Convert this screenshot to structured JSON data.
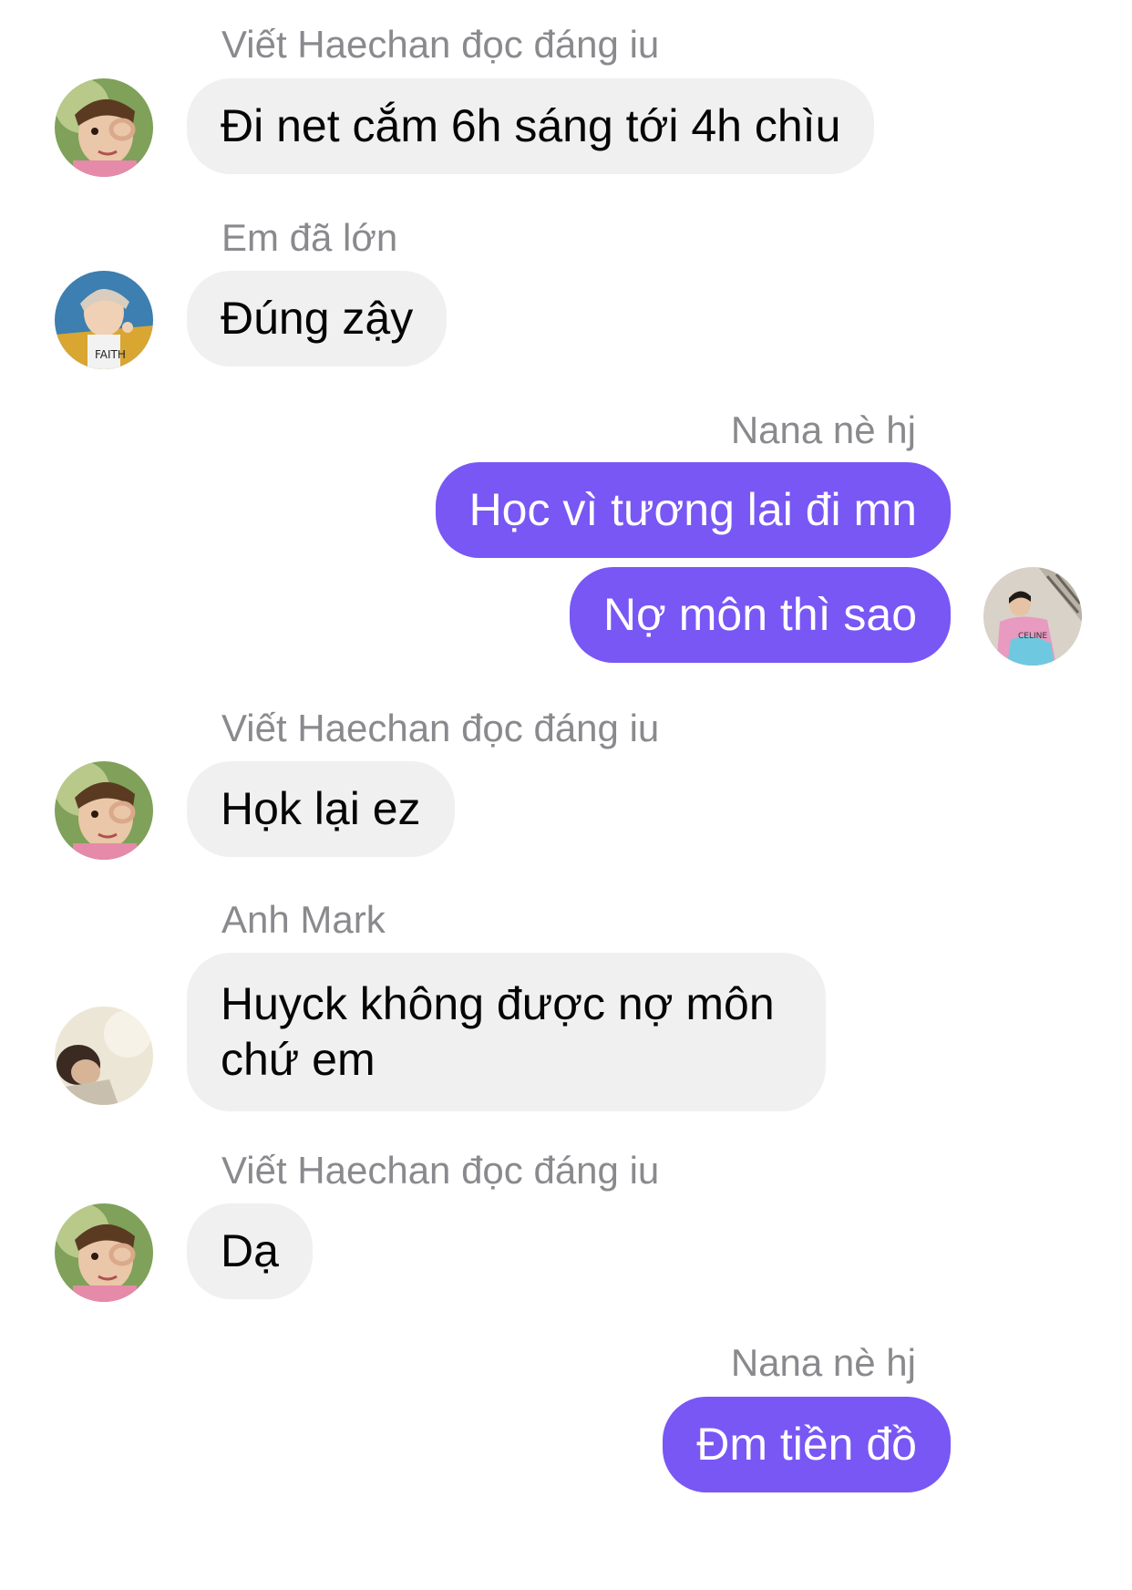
{
  "messages": [
    {
      "sender": "Viết Haechan đọc đáng iu",
      "text": "Đi net cắm 6h sáng tới 4h chìu",
      "avatar": "haechan-avatar"
    },
    {
      "sender": "Em đã lớn",
      "text": "Đúng zậy",
      "avatar": "em-da-lon-avatar"
    },
    {
      "sender": "Nana nè hj",
      "texts": [
        "Học vì tương lai đi mn",
        "Nợ môn thì sao"
      ],
      "avatar": "nana-avatar"
    },
    {
      "sender": "Viết Haechan đọc đáng iu",
      "text": "Họk lại ez",
      "avatar": "haechan-avatar"
    },
    {
      "sender": "Anh Mark",
      "text": "Huyck không được nợ môn chứ em",
      "avatar": "mark-avatar"
    },
    {
      "sender": "Viết Haechan đọc đáng iu",
      "text": "Dạ",
      "avatar": "haechan-avatar"
    },
    {
      "sender": "Nana nè hj",
      "text": "Đm tiền đồ"
    }
  ],
  "colors": {
    "incoming_bubble": "#f0f0f0",
    "outgoing_bubble": "#7857f5",
    "sender_name": "#8a8a8e"
  }
}
